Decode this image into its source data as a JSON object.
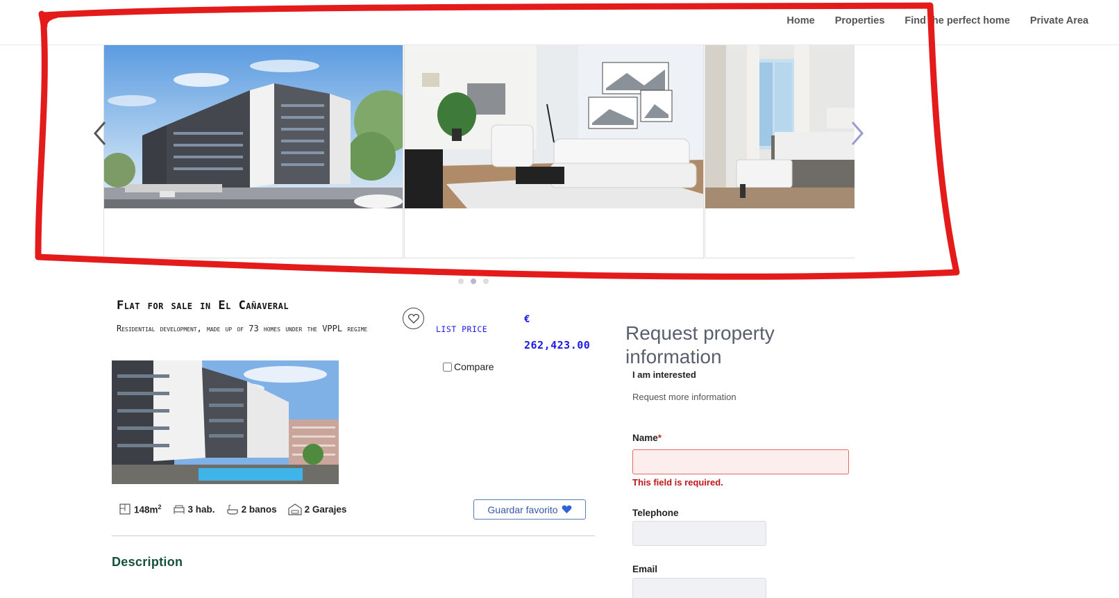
{
  "nav": {
    "items": [
      {
        "label": "Home"
      },
      {
        "label": "Properties"
      },
      {
        "label": "Find the perfect home"
      },
      {
        "label": "Private Area"
      }
    ]
  },
  "carousel": {
    "slides": [
      "building-exterior",
      "living-room",
      "bedroom"
    ],
    "dots": 3,
    "active_dot": 1
  },
  "listing": {
    "title": "Flat for sale in El Cañaveral",
    "subtitle": "Residential development, made up of 73 homes under the VPPL regime",
    "price_label": "LIST PRICE",
    "currency": "€",
    "price": "262,423.00",
    "compare_label": "Compare",
    "features": {
      "area": "148m",
      "area_unit_sup": "2",
      "rooms": "3 hab.",
      "baths": "2 banos",
      "garages": "2 Garajes"
    },
    "save_favorite": "Guardar favorito",
    "description_heading": "Description"
  },
  "form": {
    "heading": "Request property information",
    "interest": "I am interested",
    "more_info": "Request more information",
    "name_label": "Name",
    "required_mark": "*",
    "name_value": "",
    "name_error": "This field is required.",
    "telephone_label": "Telephone",
    "telephone_value": "",
    "email_label": "Email",
    "email_value": ""
  },
  "colors": {
    "price": "#1a1ae6",
    "description_heading": "#16503a",
    "error": "#c0161b",
    "annotation": "#e31b1b"
  }
}
